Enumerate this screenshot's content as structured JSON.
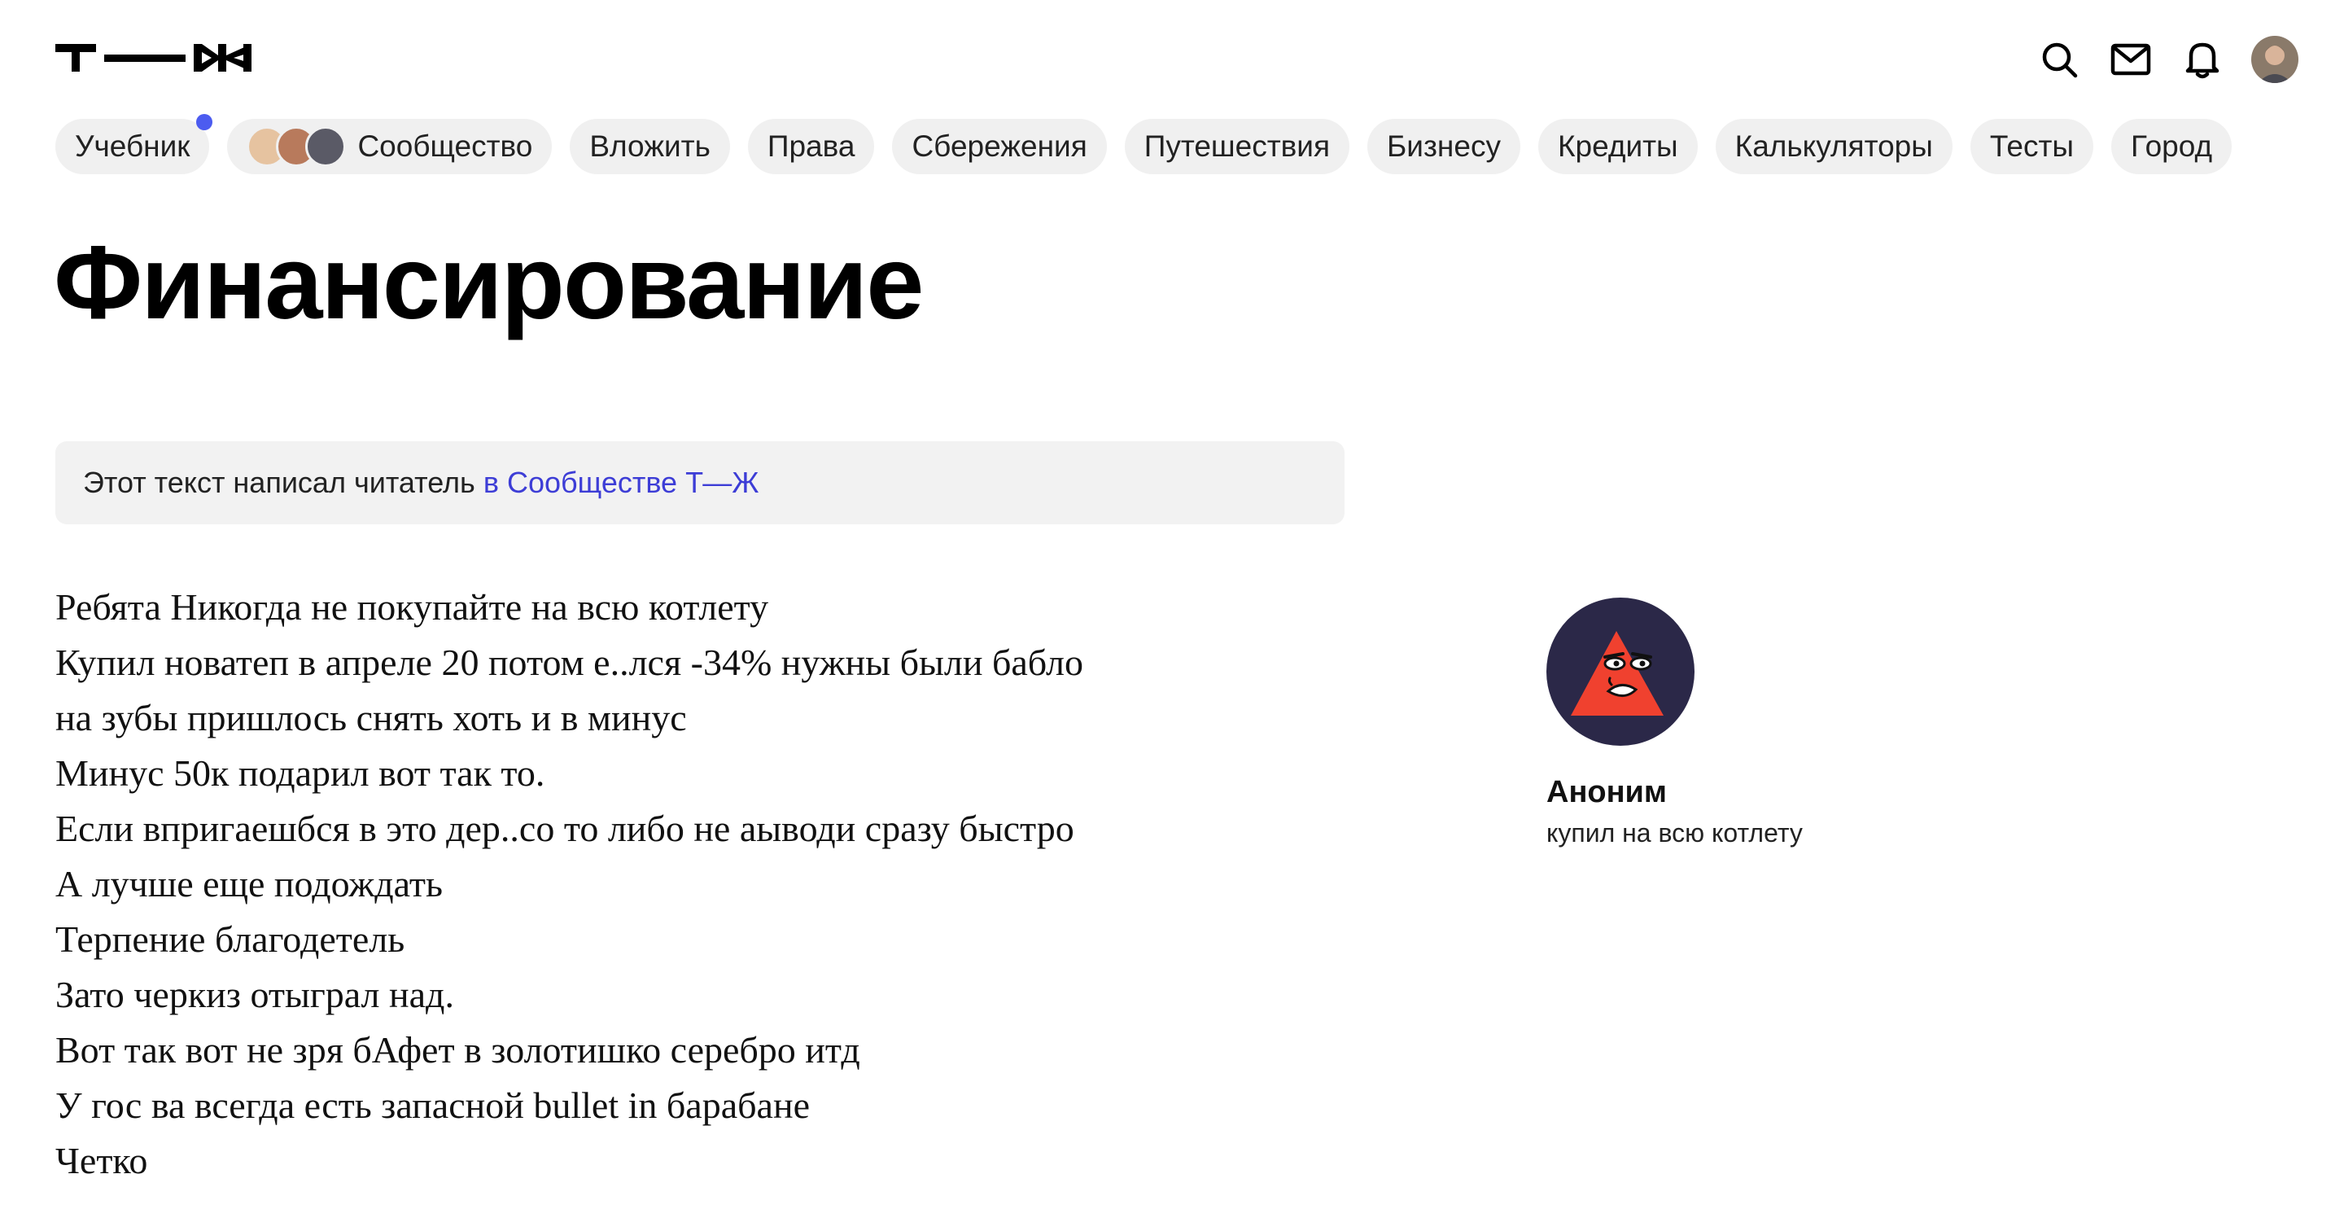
{
  "header": {
    "logo_icon": "tzh-logo-icon",
    "icons": [
      "search-icon",
      "mail-icon",
      "bell-icon",
      "user-avatar"
    ]
  },
  "nav": {
    "items": [
      {
        "label": "Учебник",
        "has_dot": true
      },
      {
        "label": "Сообщество",
        "has_avatars": true
      },
      {
        "label": "Вложить"
      },
      {
        "label": "Права"
      },
      {
        "label": "Сбережения"
      },
      {
        "label": "Путешествия"
      },
      {
        "label": "Бизнесу"
      },
      {
        "label": "Кредиты"
      },
      {
        "label": "Калькуляторы"
      },
      {
        "label": "Тесты"
      },
      {
        "label": "Город"
      }
    ]
  },
  "page": {
    "title": "Финансирование"
  },
  "notice": {
    "text": "Этот текст написал читатель",
    "link": "в Сообществе Т—Ж"
  },
  "article": {
    "lines": [
      "Ребята Никогда не покупайте на всю котлету",
      "Купил новатеп в апреле 20 потом е..лся -34% нужны были бабло",
      "на зубы пришлось снять хоть и в минус",
      "Минус 50к подарил вот так то.",
      "Если впригаешбся в это дер..со то либо не аыводи сразу быстро",
      "А лучше еще подождать",
      "Терпение благодетель",
      "Зато черкиз отыграл над.",
      "Вот так вот не зря бАфет в золотишко серебро итд",
      "У гос ва всегда есть запасной bullet in барабане",
      "Четко"
    ]
  },
  "author": {
    "name": "Аноним",
    "subtitle": "купил на всю котлету",
    "avatar_icon": "anonymous-triangle-icon"
  },
  "colors": {
    "accent_link": "#3d3dd6",
    "nav_dot": "#4c5cf0",
    "pill_bg": "#f0f0f0",
    "notice_bg": "#f2f2f2",
    "author_avatar_bg": "#2b2848",
    "author_avatar_triangle": "#f0412f"
  }
}
